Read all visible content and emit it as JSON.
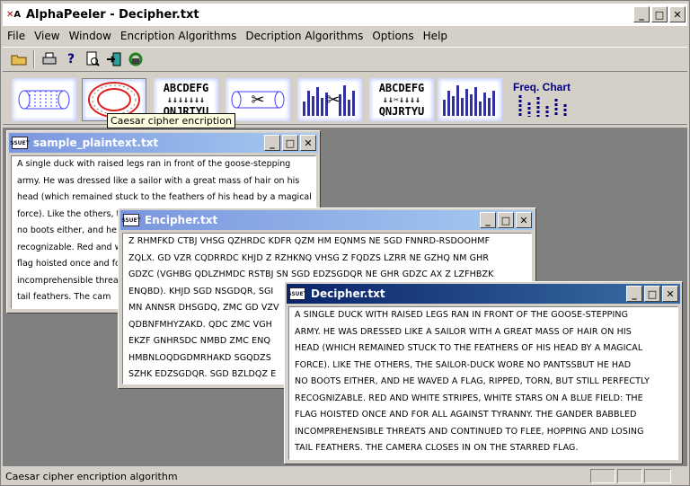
{
  "app": {
    "title": "AlphaPeeler - Decipher.txt"
  },
  "menu": [
    "File",
    "View",
    "Window",
    "Encription Algorithms",
    "Decription Algorithms",
    "Options",
    "Help"
  ],
  "toolbar_icons": [
    "open-folder-icon",
    "print-icon",
    "help-icon",
    "print-preview-icon",
    "exit-icon",
    "recycle-icon"
  ],
  "algorithm_icons": [
    "caesar-cipher-icon",
    "caesar-wheel-icon",
    "substitution-icon",
    "scissors-icon",
    "vigenere-chart-icon",
    "substitution-scissors-icon",
    "bar-chart-icon",
    "freq-chart-icon"
  ],
  "algo_labels": {
    "substitution": "ABCDEFG\nQNJRTYU",
    "substitution2": "ABCDEFG\nQNJRTYU",
    "freq": "Freq. Chart"
  },
  "tooltip": "Caesar cipher encription",
  "status": {
    "text": "Caesar cipher encription algorithm"
  },
  "windows": {
    "plain": {
      "title": "sample_plaintext.txt",
      "lines": [
        "A single duck with raised legs ran in front of the goose-stepping",
        "army. He was dressed like a sailor with a great mass of hair on his",
        "head (which remained stuck to the feathers of his head by a magical",
        "force). Like the others, the s",
        "no boots either, and he wav",
        "recognizable. Red and wh",
        "flag hoisted once and for a",
        "incomprehensible threats a",
        "tail feathers. The cam"
      ]
    },
    "encipher": {
      "title": "Encipher.txt",
      "lines": [
        "Z RHMFKD CTBJ VHSG QZHRDC KDFR QZM HM EQNMS NE SGD FNNRD-RSDOOHMF",
        "ZQLX. GD VZR CQDRRDC KHJD Z RZHKNQ VHSG Z FQDZS LZRR NE GZHQ NM GHR",
        "GDZC (VGHBG QDLZHMDC RSTBJ SN SGD EDZSGDQR NE GHR GDZC AX Z LZFHBZK",
        "ENQBD). KHJD SGD NSGDQR, SGI",
        "MN ANNSR DHSGDQ, ZMC GD VZV",
        "QDBNFMHYZAKD. QDC ZMC VGH",
        "EKZF GNHRSDC NMBD ZMC ENQ",
        "HMBNLOQDGDMRHAKD SGQDZS",
        "SZHK EDZSGDQR. SGD BZLDQZ E"
      ]
    },
    "decipher": {
      "title": "Decipher.txt",
      "lines": [
        "A SINGLE DUCK WITH RAISED LEGS RAN IN FRONT OF THE GOOSE-STEPPING",
        "ARMY. HE WAS DRESSED LIKE A SAILOR WITH A GREAT MASS OF HAIR ON HIS",
        "HEAD (WHICH REMAINED STUCK TO THE FEATHERS OF HIS HEAD BY A MAGICAL",
        "FORCE). LIKE THE OTHERS, THE SAILOR-DUCK WORE NO PANTSSBUT HE HAD",
        "NO BOOTS EITHER, AND HE WAVED A FLAG, RIPPED, TORN, BUT STILL PERFECTLY",
        "RECOGNIZABLE. RED AND WHITE STRIPES, WHITE STARS ON A BLUE FIELD: THE",
        "FLAG HOISTED ONCE AND FOR ALL AGAINST TYRANNY. THE GANDER BABBLED",
        "INCOMPREHENSIBLE THREATS AND CONTINUED TO FLEE, HOPPING AND LOSING",
        "TAIL FEATHERS. THE CAMERA CLOSES IN ON THE STARRED FLAG."
      ]
    }
  }
}
